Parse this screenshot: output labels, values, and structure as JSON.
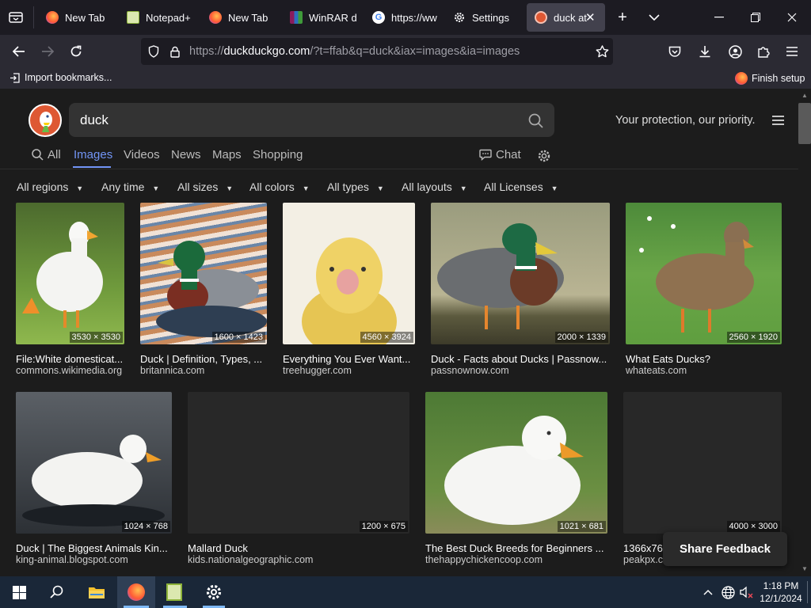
{
  "browser": {
    "tabs": [
      {
        "label": "",
        "icon": "tab-overview-icon"
      },
      {
        "label": "New Tab",
        "icon": "firefox-icon"
      },
      {
        "label": "Notepad+",
        "icon": "notepad-icon"
      },
      {
        "label": "New Tab",
        "icon": "firefox-icon"
      },
      {
        "label": "WinRAR d",
        "icon": "winrar-icon"
      },
      {
        "label": "https://ww",
        "icon": "google-icon"
      },
      {
        "label": "Settings",
        "icon": "gear-icon"
      },
      {
        "label": "duck at",
        "icon": "duckduckgo-icon"
      }
    ],
    "url_prefix": "https://",
    "url_host": "duckduckgo.com",
    "url_path": "/?t=ffab&q=duck&iax=images&ia=images",
    "import_bookmarks": "Import bookmarks...",
    "finish_setup": "Finish setup"
  },
  "ddg": {
    "query": "duck",
    "tagline": "Your protection, our priority.",
    "tabs": [
      "All",
      "Images",
      "Videos",
      "News",
      "Maps",
      "Shopping"
    ],
    "active_tab": "Images",
    "chat": "Chat",
    "filters": [
      "All regions",
      "Any time",
      "All sizes",
      "All colors",
      "All types",
      "All layouts",
      "All Licenses"
    ],
    "share_feedback": "Share Feedback"
  },
  "images": [
    {
      "title": "File:White domesticat...",
      "source": "commons.wikimedia.org",
      "dims": "3530 × 3530"
    },
    {
      "title": "Duck | Definition, Types, ...",
      "source": "britannica.com",
      "dims": "1600 × 1423"
    },
    {
      "title": "Everything You Ever Want...",
      "source": "treehugger.com",
      "dims": "4560 × 3924"
    },
    {
      "title": "Duck - Facts about Ducks | Passnow...",
      "source": "passnownow.com",
      "dims": "2000 × 1339"
    },
    {
      "title": "What Eats Ducks?",
      "source": "whateats.com",
      "dims": "2560 × 1920"
    },
    {
      "title": "Duck | The Biggest Animals Kin...",
      "source": "king-animal.blogspot.com",
      "dims": "1024 × 768"
    },
    {
      "title": "Mallard Duck",
      "source": "kids.nationalgeographic.com",
      "dims": "1200 × 675"
    },
    {
      "title": "The Best Duck Breeds for Beginners ...",
      "source": "thehappychickencoop.com",
      "dims": "1021 × 681"
    },
    {
      "title": "1366x76",
      "source": "peakpx.c",
      "dims": "4000 × 3000"
    }
  ],
  "taskbar": {
    "time": "1:18 PM",
    "date": "12/1/2024"
  },
  "colors": {
    "accent": "#7295f6",
    "ddg_orange": "#de5833"
  }
}
